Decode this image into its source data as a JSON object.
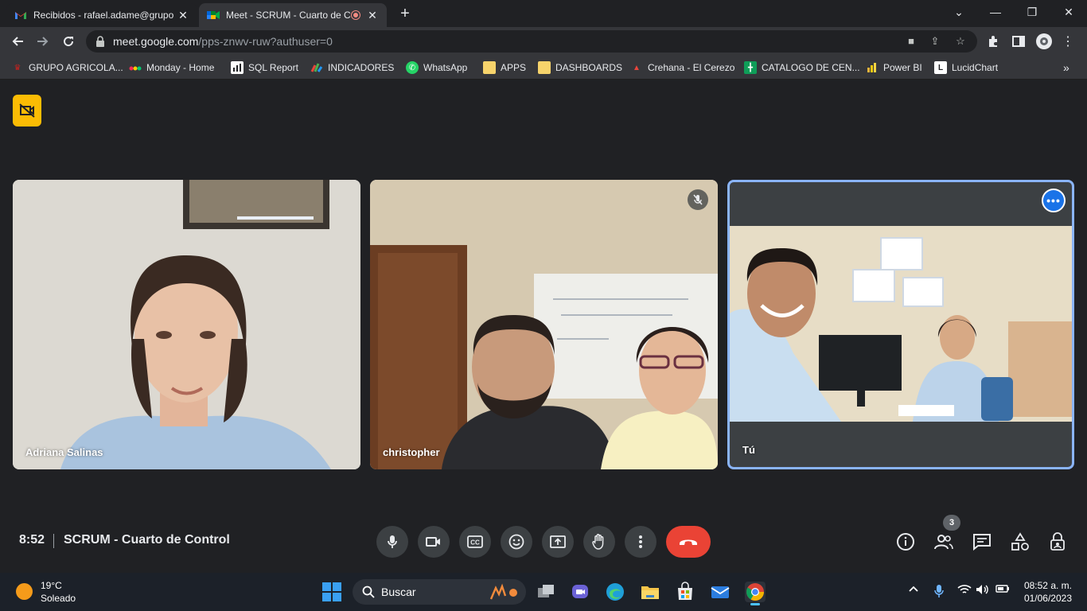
{
  "browser": {
    "tabs": [
      {
        "title": "Recibidos - rafael.adame@grupo",
        "favicon": "gmail-icon",
        "active": false
      },
      {
        "title": "Meet - SCRUM - Cuarto de C",
        "favicon": "meet-icon",
        "active": true
      }
    ],
    "address": {
      "host": "meet.google.com",
      "path": "/pps-znwv-ruw?authuser=0"
    },
    "bookmarks": [
      {
        "label": "GRUPO AGRICOLA...",
        "icon": "crown-icon"
      },
      {
        "label": "Monday - Home",
        "icon": "monday-icon"
      },
      {
        "label": "SQL Report",
        "icon": "report-icon"
      },
      {
        "label": "INDICADORES",
        "icon": "indicators-icon"
      },
      {
        "label": "WhatsApp",
        "icon": "whatsapp-icon"
      },
      {
        "label": "APPS",
        "icon": "folder-icon"
      },
      {
        "label": "DASHBOARDS",
        "icon": "folder-icon"
      },
      {
        "label": "Crehana - El Cerezo",
        "icon": "crehana-icon"
      },
      {
        "label": "CATALOGO DE CEN...",
        "icon": "sheets-icon"
      },
      {
        "label": "Power BI",
        "icon": "powerbi-icon"
      },
      {
        "label": "LucidChart",
        "icon": "lucidchart-icon"
      }
    ]
  },
  "meet": {
    "participants": [
      {
        "name": "Adriana Salinas",
        "muted": false
      },
      {
        "name": "christopher",
        "muted": true
      },
      {
        "name": "Tú",
        "muted": false,
        "self": true
      }
    ],
    "time": "8:52",
    "meeting_title": "SCRUM - Cuarto de Control",
    "people_count": "3",
    "colors": {
      "hangup": "#ea4335",
      "active_border": "#8ab4f8",
      "badge": "#fbbc04"
    }
  },
  "taskbar": {
    "weather_temp": "19°C",
    "weather_condition": "Soleado",
    "search_placeholder": "Buscar",
    "time": "08:52 a. m.",
    "date": "01/06/2023"
  }
}
